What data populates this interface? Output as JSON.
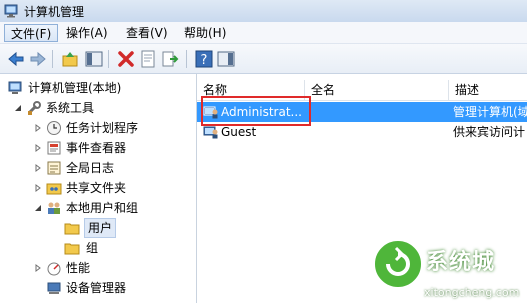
{
  "window": {
    "title": "计算机管理"
  },
  "menu": {
    "items": [
      {
        "label": "文件(F)"
      },
      {
        "label": "操作(A)"
      },
      {
        "label": "查看(V)"
      },
      {
        "label": "帮助(H)"
      }
    ]
  },
  "tree": {
    "root": "计算机管理(本地)",
    "system_tools": "系统工具",
    "task_scheduler": "任务计划程序",
    "event_viewer": "事件查看器",
    "shared_folders": "共享文件夹",
    "local_users_groups": "本地用户和组",
    "users": "用户",
    "groups": "组",
    "performance": "性能",
    "device_manager": "设备管理器"
  },
  "list": {
    "columns": [
      "名称",
      "全名",
      "描述"
    ],
    "rows": [
      {
        "name": "Administrat...",
        "fullname": "",
        "description": "管理计算机(域"
      },
      {
        "name": "Guest",
        "fullname": "",
        "description": "供来宾访问计"
      }
    ]
  },
  "watermark": {
    "brand": "系统城",
    "url": "xitongcheng.com"
  },
  "colors": {
    "selection": "#3399ff",
    "highlight_box": "#e02a2a"
  }
}
